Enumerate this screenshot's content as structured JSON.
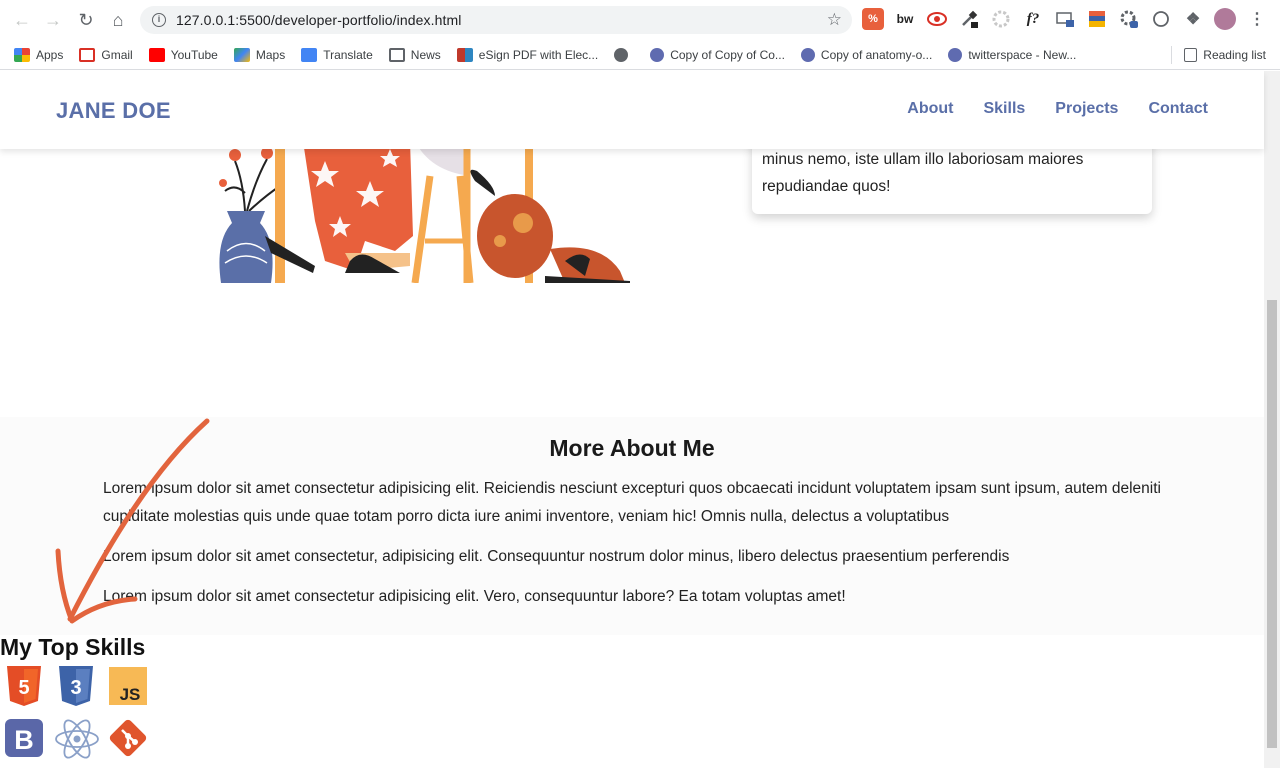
{
  "browser": {
    "url": "127.0.0.1:5500/developer-portfolio/index.html",
    "extensions": [
      "%",
      "bw",
      "f?"
    ],
    "bookmarks": [
      {
        "label": "Apps",
        "icon": "apps-grid-icon",
        "color": "#ea4335"
      },
      {
        "label": "Gmail",
        "icon": "gmail-icon",
        "color": "#d93025"
      },
      {
        "label": "YouTube",
        "icon": "youtube-icon",
        "color": "#ff0000"
      },
      {
        "label": "Maps",
        "icon": "maps-icon",
        "color": "#34a853"
      },
      {
        "label": "Translate",
        "icon": "translate-icon",
        "color": "#4285f4"
      },
      {
        "label": "News",
        "icon": "news-icon",
        "color": "#5f6368"
      },
      {
        "label": "eSign PDF with Elec...",
        "icon": "esign-icon",
        "color": "#c0392b"
      },
      {
        "label": "",
        "icon": "globe-icon",
        "color": "#5f6368"
      },
      {
        "label": "Copy of Copy of Co...",
        "icon": "c-icon",
        "color": "#5f6bb0"
      },
      {
        "label": "Copy of anatomy-o...",
        "icon": "c-icon",
        "color": "#5f6bb0"
      },
      {
        "label": "twitterspace - New...",
        "icon": "c-icon",
        "color": "#5f6bb0"
      }
    ],
    "reading_list": "Reading list"
  },
  "site": {
    "logo": "JANE DOE",
    "nav": [
      "About",
      "Skills",
      "Projects",
      "Contact"
    ],
    "about_card_text": "minus nemo, iste ullam illo laboriosam maiores repudiandae quos!",
    "more_title": "More About Me",
    "paragraphs": [
      "Lorem ipsum dolor sit amet consectetur adipisicing elit. Reiciendis nesciunt excepturi quos obcaecati incidunt voluptatem ipsam sunt ipsum, autem deleniti cupiditate molestias quis unde quae totam porro dicta iure animi inventore, veniam hic! Omnis nulla, delectus a voluptatibus",
      "Lorem ipsum dolor sit amet consectetur, adipisicing elit. Consequuntur nostrum dolor minus, libero delectus praesentium perferendis",
      "Lorem ipsum dolor sit amet consectetur adipisicing elit. Vero, consequuntur labore? Ea totam voluptas amet!"
    ],
    "skills_title": "My Top Skills",
    "skills": [
      {
        "name": "html5-icon",
        "label": "5",
        "color": "#e44d26"
      },
      {
        "name": "css3-icon",
        "label": "3",
        "color": "#3d63a8"
      },
      {
        "name": "javascript-icon",
        "label": "JS",
        "color": "#f7b955"
      },
      {
        "name": "bootstrap-icon",
        "label": "B",
        "color": "#5a67a8"
      },
      {
        "name": "react-icon",
        "label": "",
        "color": "#8aa0c8"
      },
      {
        "name": "git-icon",
        "label": "",
        "color": "#e0552d"
      }
    ]
  },
  "colors": {
    "accent": "#5a6fa8",
    "annotation": "#e2643d"
  }
}
